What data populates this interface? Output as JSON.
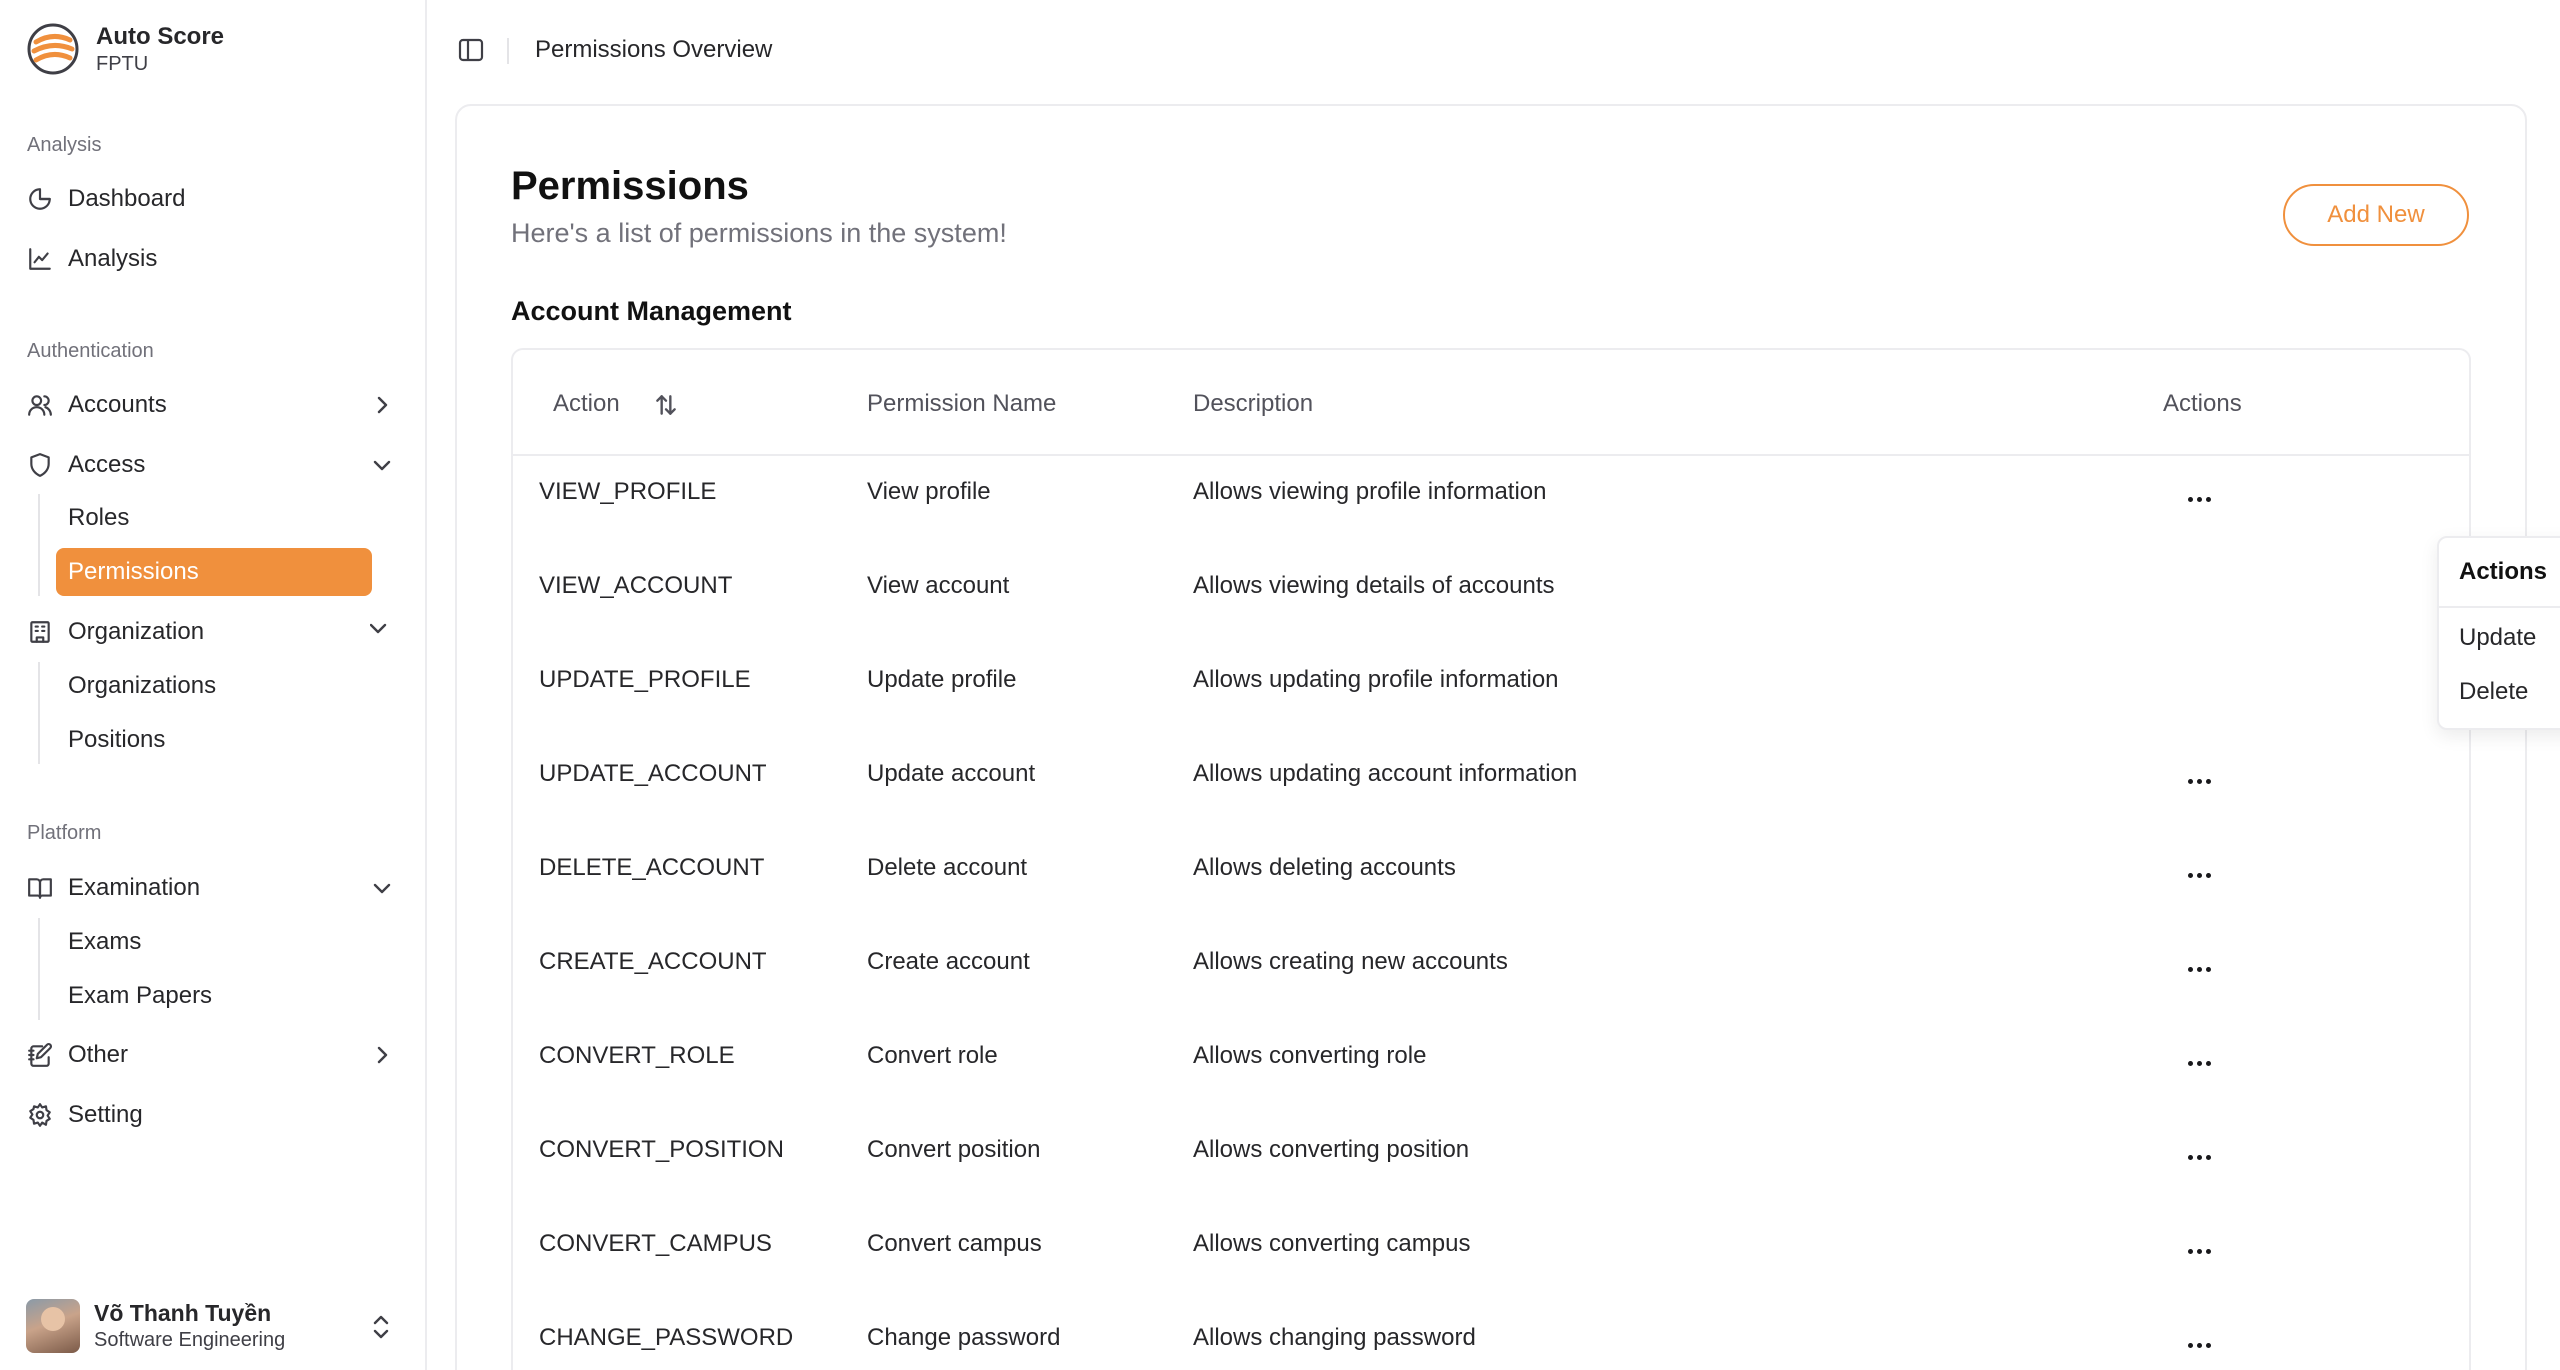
{
  "brand": {
    "title": "Auto Score",
    "subtitle": "FPTU"
  },
  "colors": {
    "accent": "#f0903d"
  },
  "sidebar": {
    "sections": {
      "analysis": "Analysis",
      "authentication": "Authentication",
      "platform": "Platform"
    },
    "dashboard": "Dashboard",
    "analysis": "Analysis",
    "accounts": "Accounts",
    "access": "Access",
    "access_items": [
      "Roles",
      "Permissions"
    ],
    "organization": "Organization",
    "organization_items": [
      "Organizations",
      "Positions"
    ],
    "examination": "Examination",
    "examination_items": [
      "Exams",
      "Exam Papers"
    ],
    "other": "Other",
    "setting": "Setting"
  },
  "user": {
    "name": "Võ Thanh Tuyền",
    "role": "Software Engineering"
  },
  "header": {
    "breadcrumb": "Permissions Overview"
  },
  "page": {
    "title": "Permissions",
    "subtitle": "Here's a list of permissions in the system!",
    "add_button": "Add New",
    "group_title": "Account Management"
  },
  "table": {
    "columns": [
      "Action",
      "Permission Name",
      "Description",
      "Actions"
    ],
    "rows": [
      [
        "VIEW_PROFILE",
        "View profile",
        "Allows viewing profile information"
      ],
      [
        "VIEW_ACCOUNT",
        "View account",
        "Allows viewing details of accounts"
      ],
      [
        "UPDATE_PROFILE",
        "Update profile",
        "Allows updating profile information"
      ],
      [
        "UPDATE_ACCOUNT",
        "Update account",
        "Allows updating account information"
      ],
      [
        "DELETE_ACCOUNT",
        "Delete account",
        "Allows deleting accounts"
      ],
      [
        "CREATE_ACCOUNT",
        "Create account",
        "Allows creating new accounts"
      ],
      [
        "CONVERT_ROLE",
        "Convert role",
        "Allows converting role"
      ],
      [
        "CONVERT_POSITION",
        "Convert position",
        "Allows converting position"
      ],
      [
        "CONVERT_CAMPUS",
        "Convert campus",
        "Allows converting campus"
      ],
      [
        "CHANGE_PASSWORD",
        "Change password",
        "Allows changing password"
      ]
    ]
  },
  "menu": {
    "label": "Actions",
    "items": [
      "Update",
      "Delete"
    ]
  }
}
